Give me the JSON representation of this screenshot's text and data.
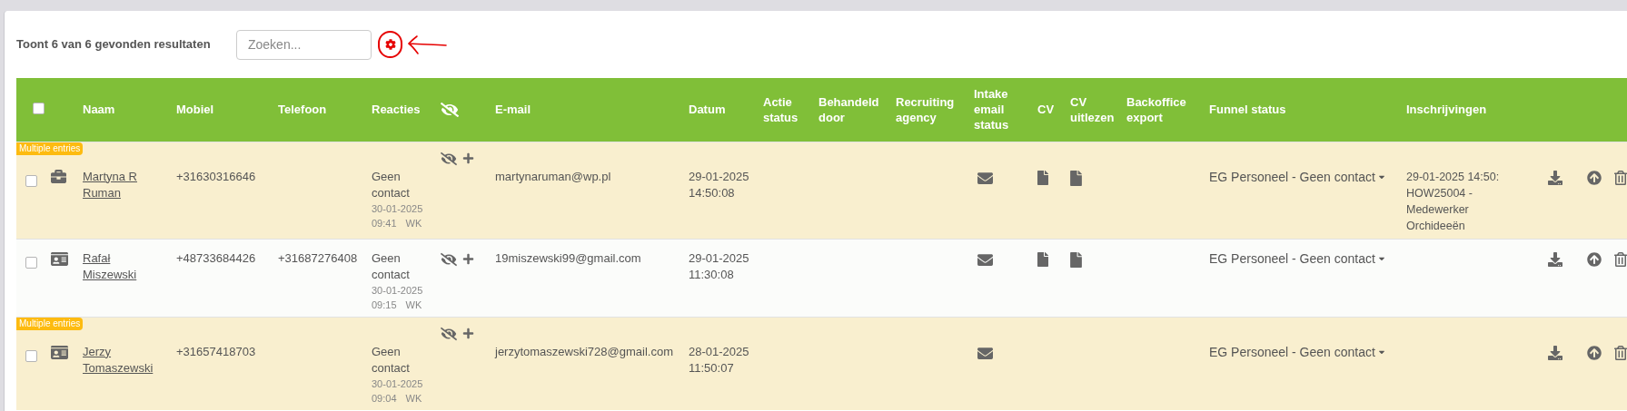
{
  "summary": "Toont 6 van 6 gevonden resultaten",
  "search": {
    "placeholder": "Zoeken..."
  },
  "table": {
    "header_checkbox": {
      "checked": false
    },
    "columns": [
      "Naam",
      "Mobiel",
      "Telefoon",
      "Reacties",
      "E-mail",
      "Datum",
      "Actie status",
      "Behandeld door",
      "Recruiting agency",
      "Intake email status",
      "CV",
      "CV uitlezen",
      "Backoffice export",
      "Funnel status",
      "Inschrijvingen"
    ],
    "rows": [
      {
        "checked": false,
        "highlighted": true,
        "badge": "Multiple entries",
        "kind": "briefcase",
        "name": "Martyna R Ruman",
        "mobile": "+31630316646",
        "reaction": {
          "status": "Geen contact",
          "date": "30-01-2025",
          "time": "09:41",
          "by": "WK"
        },
        "email": "martynaruman@wp.pl",
        "date": "29-01-2025 14:50:08",
        "intake_email": true,
        "cv": true,
        "cv_parse": true,
        "funnel": "EG Personeel - Geen contact",
        "registration": "29-01-2025 14:50: HOW25004 - Medewerker Orchideeën"
      },
      {
        "checked": false,
        "highlighted": false,
        "kind": "card",
        "name": "Rafał Miszewski",
        "mobile": "+48733684426",
        "phone": "+31687276408",
        "reaction": {
          "status": "Geen contact",
          "date": "30-01-2025",
          "time": "09:15",
          "by": "WK"
        },
        "email": "19miszewski99@gmail.com",
        "date": "29-01-2025 11:30:08",
        "intake_email": true,
        "cv": true,
        "cv_parse": true,
        "funnel": "EG Personeel - Geen contact"
      },
      {
        "checked": false,
        "highlighted": true,
        "badge": "Multiple entries",
        "kind": "card",
        "name": "Jerzy Tomaszewski",
        "mobile": "+31657418703",
        "reaction": {
          "status": "Geen contact",
          "date": "30-01-2025",
          "time": "09:04",
          "by": "WK"
        },
        "email": "jerzytomaszewski728@gmail.com",
        "date": "28-01-2025 11:50:07",
        "intake_email": true,
        "cv": false,
        "cv_parse": false,
        "funnel": "EG Personeel - Geen contact"
      }
    ]
  }
}
